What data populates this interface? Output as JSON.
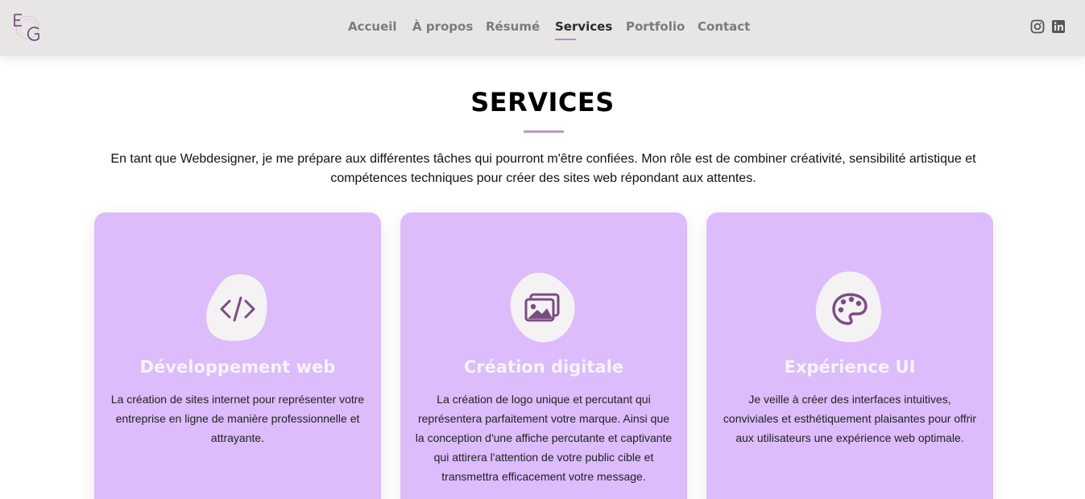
{
  "brand": {
    "logo_text": "EG"
  },
  "nav": {
    "items": [
      {
        "label": "Accueil"
      },
      {
        "label": "À propos"
      },
      {
        "label": "Résumé"
      },
      {
        "label": "Services",
        "active": true
      },
      {
        "label": "Portfolio"
      },
      {
        "label": "Contact"
      }
    ]
  },
  "social": [
    {
      "icon": "instagram-icon"
    },
    {
      "icon": "linkedin-icon"
    }
  ],
  "section": {
    "title": "SERVICES",
    "intro": "En tant que Webdesigner, je me prépare aux différentes tâches qui pourront m'être confiées. Mon rôle est de combiner créativité, sensibilité artistique et compétences techniques pour créer des sites web répondant aux attentes."
  },
  "cards": [
    {
      "icon": "code-icon",
      "title": "Développement web",
      "text": "La création de sites internet pour représenter votre entreprise en ligne de manière professionnelle et attrayante."
    },
    {
      "icon": "images-icon",
      "title": "Création digitale",
      "text": "La création de logo unique et percutant qui représentera parfaitement votre marque. Ainsi que la conception d'une affiche percutante et captivante qui attirera l'attention de votre public cible et transmettra efficacement votre message."
    },
    {
      "icon": "palette-icon",
      "title": "Expérience UI",
      "text": "Je veille à créer des interfaces intuitives, conviviales et esthétiquement plaisantes pour offrir aux utilisateurs une expérience web optimale."
    }
  ],
  "colors": {
    "header_bg": "#e8e6e4",
    "card_bg": "#dcbcfb",
    "accent": "#b89cc4",
    "icon_purple": "#7a4c83"
  }
}
